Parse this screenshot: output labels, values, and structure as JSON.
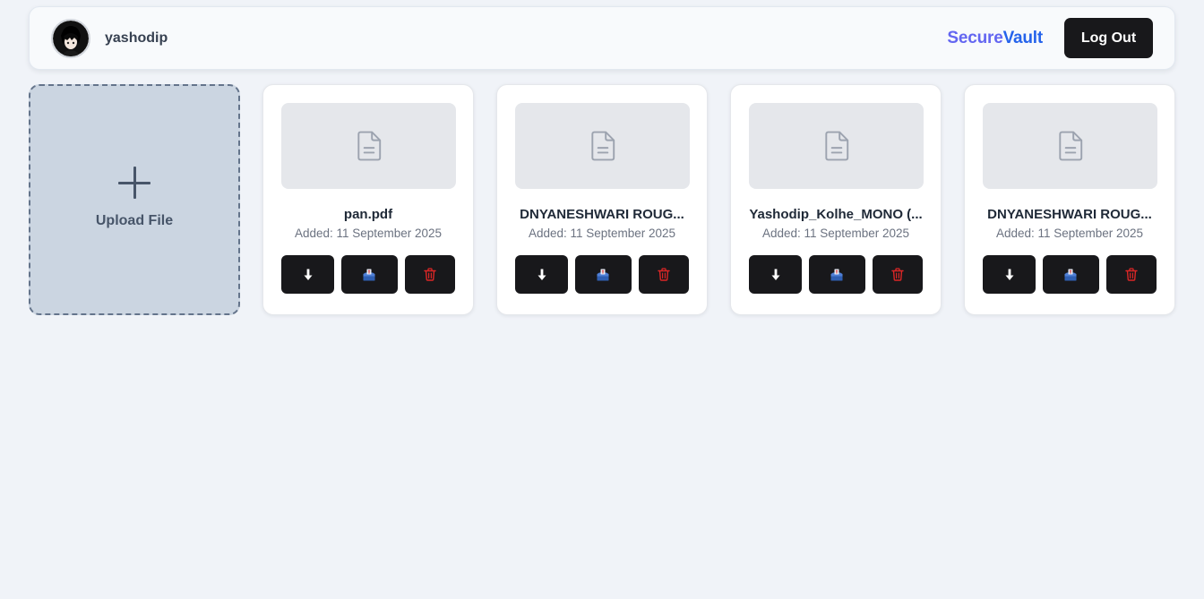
{
  "header": {
    "username": "yashodip",
    "brand_part1": "Secure",
    "brand_part2": "Vault",
    "logout_label": "Log Out"
  },
  "upload": {
    "label": "Upload File"
  },
  "files": [
    {
      "name": "pan.pdf",
      "date": "Added: 11 September 2025"
    },
    {
      "name": "DNYANESHWARI ROUG...",
      "date": "Added: 11 September 2025"
    },
    {
      "name": "Yashodip_Kolhe_MONO (...",
      "date": "Added: 11 September 2025"
    },
    {
      "name": "DNYANESHWARI ROUG...",
      "date": "Added: 11 September 2025"
    }
  ],
  "icons": {
    "download": "download-icon",
    "share": "share-icon",
    "delete": "trash-icon",
    "file": "file-icon",
    "upload": "plus-icon"
  },
  "colors": {
    "brand_secure": "#6366f1",
    "brand_vault": "#2563eb",
    "delete_icon": "#dc2626",
    "button_dark": "#18181b"
  }
}
